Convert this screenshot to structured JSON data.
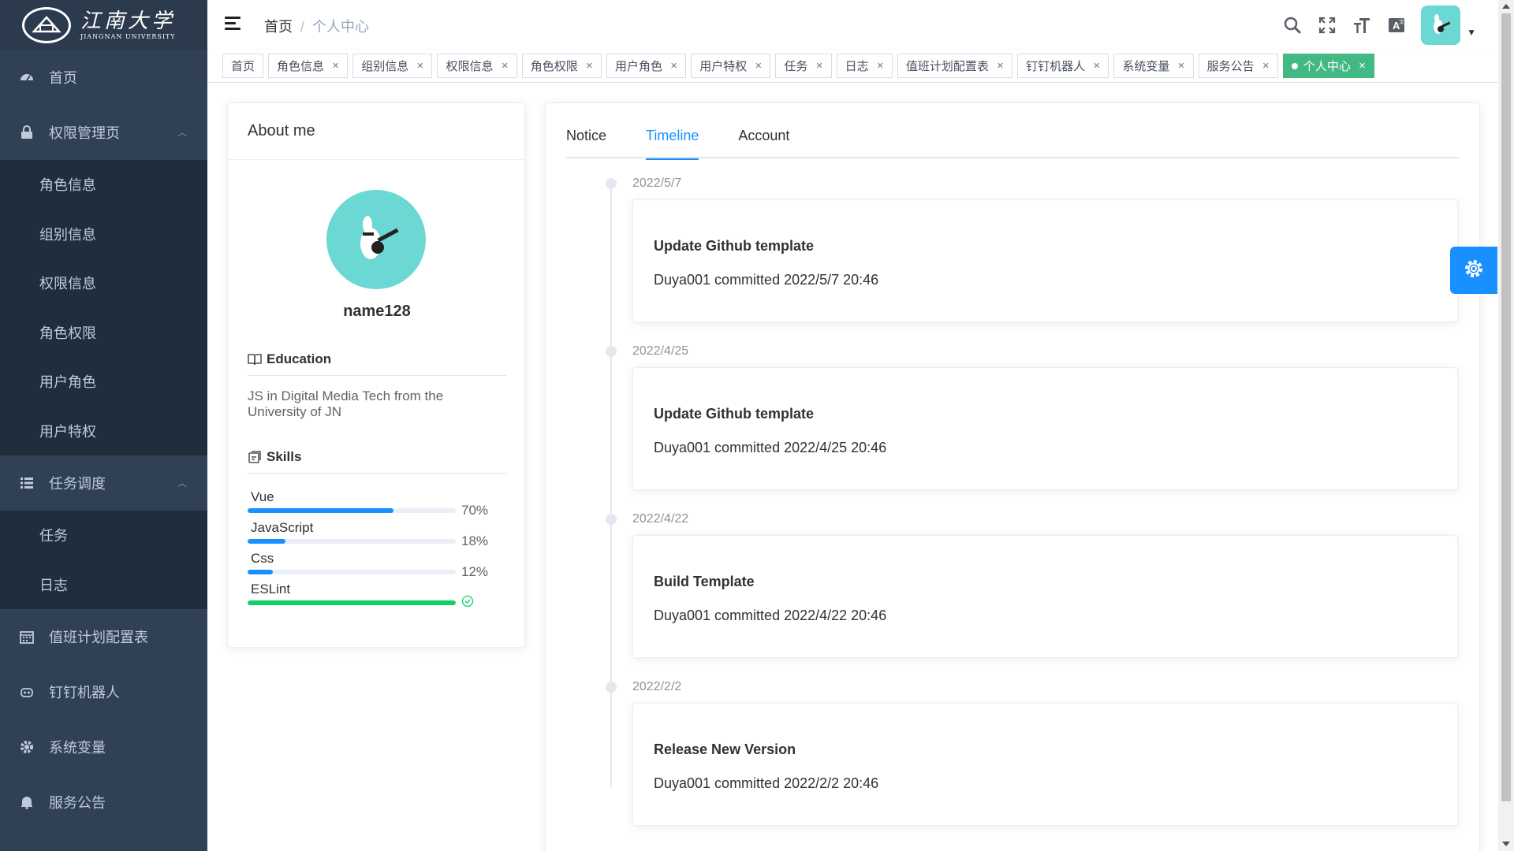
{
  "sidebar": {
    "logo": {
      "main": "江南大学",
      "sub": "JIANGNAN UNIVERSITY"
    },
    "menu": [
      {
        "label": "首页",
        "icon": "dashboard-icon"
      },
      {
        "label": "权限管理页",
        "icon": "lock-icon",
        "expanded": true
      },
      {
        "label": "任务调度",
        "icon": "list-icon",
        "expanded": true
      },
      {
        "label": "值班计划配置表",
        "icon": "calendar-icon"
      },
      {
        "label": "钉钉机器人",
        "icon": "robot-icon"
      },
      {
        "label": "系统变量",
        "icon": "gear-icon"
      },
      {
        "label": "服务公告",
        "icon": "bell-icon"
      }
    ],
    "permission_sub": [
      "角色信息",
      "组别信息",
      "权限信息",
      "角色权限",
      "用户角色",
      "用户特权"
    ],
    "task_sub": [
      "任务",
      "日志"
    ]
  },
  "header": {
    "breadcrumb": [
      "首页",
      "个人中心"
    ],
    "separator": "/"
  },
  "tags": [
    {
      "label": "首页",
      "closable": false
    },
    {
      "label": "角色信息",
      "closable": true
    },
    {
      "label": "组别信息",
      "closable": true
    },
    {
      "label": "权限信息",
      "closable": true
    },
    {
      "label": "角色权限",
      "closable": true
    },
    {
      "label": "用户角色",
      "closable": true
    },
    {
      "label": "用户特权",
      "closable": true
    },
    {
      "label": "任务",
      "closable": true
    },
    {
      "label": "日志",
      "closable": true
    },
    {
      "label": "值班计划配置表",
      "closable": true
    },
    {
      "label": "钉钉机器人",
      "closable": true
    },
    {
      "label": "系统变量",
      "closable": true
    },
    {
      "label": "服务公告",
      "closable": true
    },
    {
      "label": "个人中心",
      "closable": true,
      "active": true
    }
  ],
  "about": {
    "title": "About me",
    "name": "name128",
    "education_title": "Education",
    "education_text": "JS in Digital Media Tech from the University of JN",
    "skills_title": "Skills",
    "skills": [
      {
        "name": "Vue",
        "percent": 70,
        "label": "70%"
      },
      {
        "name": "JavaScript",
        "percent": 18,
        "label": "18%"
      },
      {
        "name": "Css",
        "percent": 12,
        "label": "12%"
      },
      {
        "name": "ESLint",
        "percent": 100,
        "label": "",
        "status": "success"
      }
    ]
  },
  "tabs": [
    {
      "label": "Notice"
    },
    {
      "label": "Timeline",
      "active": true
    },
    {
      "label": "Account"
    }
  ],
  "timeline": [
    {
      "date": "2022/5/7",
      "title": "Update Github template",
      "sub": "Duya001 committed 2022/5/7 20:46"
    },
    {
      "date": "2022/4/25",
      "title": "Update Github template",
      "sub": "Duya001 committed 2022/4/25 20:46"
    },
    {
      "date": "2022/4/22",
      "title": "Build Template",
      "sub": "Duya001 committed 2022/4/22 20:46"
    },
    {
      "date": "2022/2/2",
      "title": "Release New Version",
      "sub": "Duya001 committed 2022/2/2 20:46"
    }
  ],
  "colors": {
    "sidebar_bg": "#304156",
    "submenu_bg": "#1f2d3d",
    "primary": "#1890ff",
    "tag_active": "#42b983",
    "success": "#13ce66",
    "avatar_bg": "#6bd8d3"
  }
}
